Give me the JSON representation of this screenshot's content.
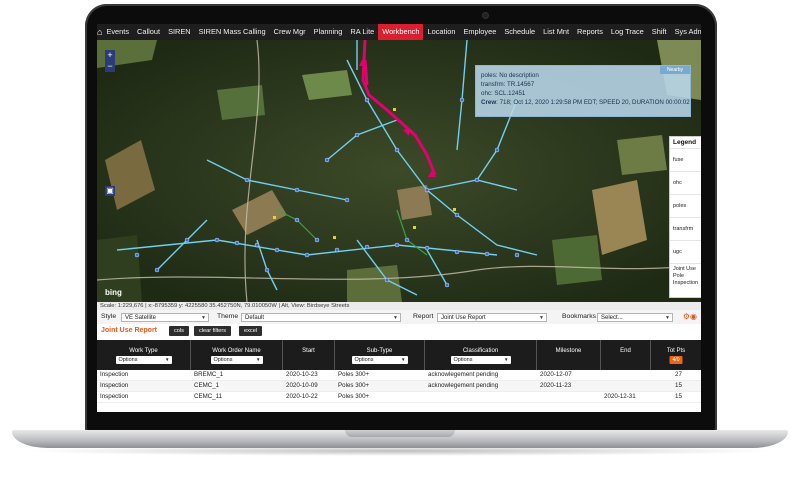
{
  "nav": {
    "items": [
      "Events",
      "Callout",
      "SIREN",
      "SIREN Mass Calling",
      "Crew Mgr",
      "Planning",
      "RA Lite",
      "Workbench",
      "Location",
      "Employee",
      "Schedule",
      "List Mnt",
      "Reports",
      "Log Trace",
      "Shift",
      "Sys Admin"
    ],
    "active_index": 7
  },
  "map": {
    "popup": {
      "header": "Nearby",
      "line1": "poles: No description",
      "line2": "transfrm: TR.14567",
      "line3": "ohc: SCL.12451",
      "crew_label": "Crew",
      "crew_text": ": 718; Oct 12, 2020 1:29:58 PM EDT; SPEED 20, DURATION 00:00:02"
    },
    "legend": {
      "title": "Legend",
      "items": [
        "fuse",
        "ohc",
        "poles",
        "transfrm",
        "ugc",
        "Joint Use Pole Inspection"
      ]
    },
    "bing_label": "bing",
    "scale_text": "Scale: 1:229,676  |  x:-8795359 y: 4225580  35.452750N, 79.010050W  |  Alt, View: Birdseye Streets"
  },
  "controls": {
    "style_label": "Style",
    "style_value": "VE Satellite",
    "theme_label": "Theme",
    "theme_value": "Default",
    "report_label": "Report",
    "report_value": "Joint Use Report",
    "bookmarks_label": "Bookmarks",
    "bookmarks_value": "Select..."
  },
  "report_bar": {
    "title": "Joint Use Report",
    "buttons": [
      "cols",
      "clear filters",
      "excel"
    ]
  },
  "table": {
    "columns": [
      "Work Type",
      "Work Order Name",
      "Start",
      "Sub-Type",
      "Classification",
      "Milestone",
      "End",
      "Tot Pts"
    ],
    "options_label": "Options",
    "badge_label": "4/0",
    "rows": [
      [
        "Inspection",
        "BREMC_1",
        "2020-10-23",
        "Poles 300+",
        "acknowlegement pending",
        "2020-12-07",
        "",
        "27"
      ],
      [
        "Inspection",
        "CEMC_1",
        "2020-10-09",
        "Poles 300+",
        "acknowlegement pending",
        "2020-11-23",
        "",
        "15"
      ],
      [
        "Inspection",
        "CEMC_11",
        "2020-10-22",
        "Poles 300+",
        "",
        "",
        "2020-12-31",
        "15"
      ]
    ]
  },
  "colors": {
    "nav_active": "#d92030",
    "accent_orange": "#e35a1c",
    "map_route": "#e4006e",
    "map_lines": "#6fd0f0"
  }
}
